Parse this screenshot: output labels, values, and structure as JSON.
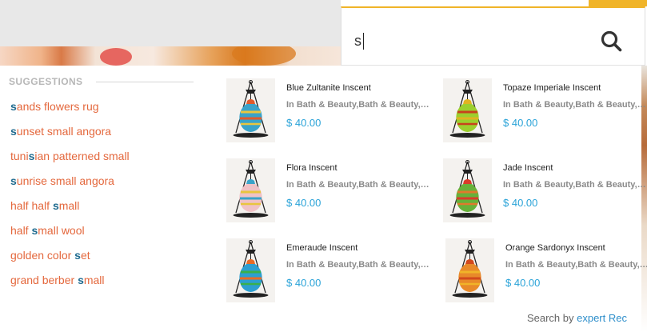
{
  "search": {
    "value": "s",
    "button_icon": "search-icon"
  },
  "suggestions": {
    "header": "SUGGESTIONS",
    "items": [
      {
        "parts": [
          {
            "t": "s",
            "hl": true
          },
          {
            "t": "ands flowers rug",
            "hl": false
          }
        ]
      },
      {
        "parts": [
          {
            "t": "s",
            "hl": true
          },
          {
            "t": "unset small angora",
            "hl": false
          }
        ]
      },
      {
        "parts": [
          {
            "t": "tuni",
            "hl": false
          },
          {
            "t": "s",
            "hl": true
          },
          {
            "t": "ian patterned small",
            "hl": false
          }
        ]
      },
      {
        "parts": [
          {
            "t": "s",
            "hl": true
          },
          {
            "t": "unrise small angora",
            "hl": false
          }
        ]
      },
      {
        "parts": [
          {
            "t": "half half ",
            "hl": false
          },
          {
            "t": "s",
            "hl": true
          },
          {
            "t": "mall",
            "hl": false
          }
        ]
      },
      {
        "parts": [
          {
            "t": "half ",
            "hl": false
          },
          {
            "t": "s",
            "hl": true
          },
          {
            "t": "mall wool",
            "hl": false
          }
        ]
      },
      {
        "parts": [
          {
            "t": "golden color ",
            "hl": false
          },
          {
            "t": "s",
            "hl": true
          },
          {
            "t": "et",
            "hl": false
          }
        ]
      },
      {
        "parts": [
          {
            "t": "grand berber ",
            "hl": false
          },
          {
            "t": "s",
            "hl": true
          },
          {
            "t": "mall",
            "hl": false
          }
        ]
      }
    ]
  },
  "products": [
    {
      "name": "Blue Zultanite Inscent",
      "category": "In Bath & Beauty,Bath & Beauty,Home Decor",
      "price": "$ 40.00",
      "colors": [
        "#3aa3c9",
        "#e05a2c",
        "#e9c53e"
      ]
    },
    {
      "name": "Topaze Imperiale Inscent",
      "category": "In Bath & Beauty,Bath & Beauty,Home Decor",
      "price": "$ 40.00",
      "colors": [
        "#9ccf2e",
        "#e2b321",
        "#c8421d"
      ]
    },
    {
      "name": "Flora Inscent",
      "category": "In Bath & Beauty,Bath & Beauty,Home Decor",
      "price": "$ 40.00",
      "colors": [
        "#f0c2c6",
        "#3aa3c9",
        "#e9c53e"
      ]
    },
    {
      "name": "Jade Inscent",
      "category": "In Bath & Beauty,Bath & Beauty,Home Decor",
      "price": "$ 40.00",
      "colors": [
        "#67b13a",
        "#d93c2a",
        "#e07a2c"
      ]
    },
    {
      "name": "Emeraude Inscent",
      "category": "In Bath & Beauty,Bath & Beauty,Home Decor",
      "price": "$ 40.00",
      "colors": [
        "#2d9fd1",
        "#e86b26",
        "#3bb04b"
      ]
    },
    {
      "name": "Orange Sardonyx Inscent",
      "category": "In Bath & Beauty,Bath & Beauty,Home Decor",
      "price": "$ 40.00",
      "colors": [
        "#e88a2a",
        "#d2491c",
        "#f0b429"
      ]
    }
  ],
  "footer": {
    "prefix": "Search by",
    "brand_1": "expert",
    "brand_2": "Rec"
  },
  "theme": {
    "accent": "#f0b429",
    "suggestion_text": "#e4683d",
    "highlight": "#1f6b8f",
    "price": "#2aa3d8"
  }
}
